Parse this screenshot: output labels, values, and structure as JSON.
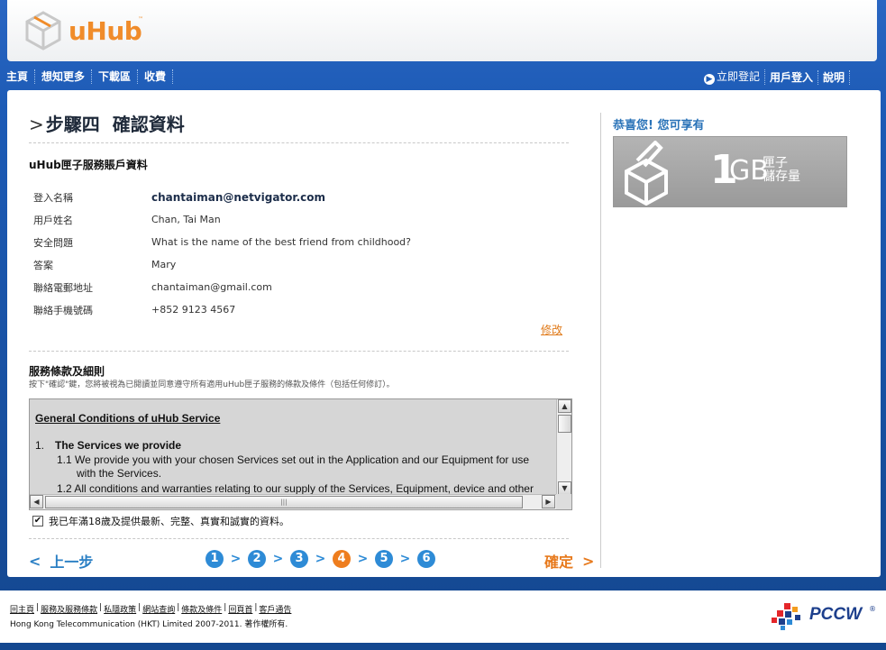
{
  "brand": {
    "name": "uHub",
    "tm": "™"
  },
  "nav": {
    "left": [
      "主頁",
      "想知更多",
      "下載區",
      "收費"
    ],
    "register": "立即登記",
    "login": "用戶登入",
    "help": "說明"
  },
  "page": {
    "title": "步驟四  確認資料"
  },
  "account": {
    "heading": "uHub匣子服務賬戶資料",
    "rows": [
      {
        "label": "登入名稱",
        "value": "chantaiman@netvigator.com"
      },
      {
        "label": "用戶姓名",
        "value": "Chan, Tai Man"
      },
      {
        "label": "安全問題",
        "value": "What is the name of the best friend from childhood?"
      },
      {
        "label": "答案",
        "value": "Mary"
      },
      {
        "label": "聯絡電郵地址",
        "value": "chantaiman@gmail.com"
      },
      {
        "label": "聯絡手機號碼",
        "value": "+852 9123 4567"
      }
    ],
    "edit": "修改"
  },
  "tos": {
    "heading": "服務條款及細則",
    "subtitle": "按下\"確認\"鍵，您將被視為已閱讀並同意遵守所有適用uHub匣子服務的條款及條件（包括任何修訂）。",
    "title": "General Conditions of uHub Service",
    "section_num": "1.",
    "section_title": "The Services we provide",
    "p1": "1.1 We provide you with your chosen Services set out in the Application and our Equipment for use with the Services.",
    "p2": "1.2 All conditions and warranties relating to our supply of the Services, Equipment, device and other",
    "agree": "我已年滿18歲及提供最新、完整、真實和誠實的資料。"
  },
  "wizard": {
    "prev": "上一步",
    "steps": [
      "1",
      "2",
      "3",
      "4",
      "5",
      "6"
    ],
    "current_step": 4,
    "confirm": "確定"
  },
  "promo": {
    "title": "恭喜您! 您可享有",
    "amount": "1",
    "unit": "GB",
    "line1": "匣子",
    "line2": "儲存量"
  },
  "footer": {
    "links": [
      "回主頁",
      "服務及服務條款",
      "私隱政策",
      "網站查詢",
      "條款及條件",
      "回頁首",
      "客戶通告"
    ],
    "copyright": "Hong Kong Telecommunication (HKT) Limited 2007-2011. 著作權所有.",
    "partner": "PCCW",
    "partner_mark": "®"
  },
  "colors": {
    "accent": "#ee7d1e",
    "step_blue": "#2e8bd6",
    "link_blue": "#2a73b8"
  }
}
